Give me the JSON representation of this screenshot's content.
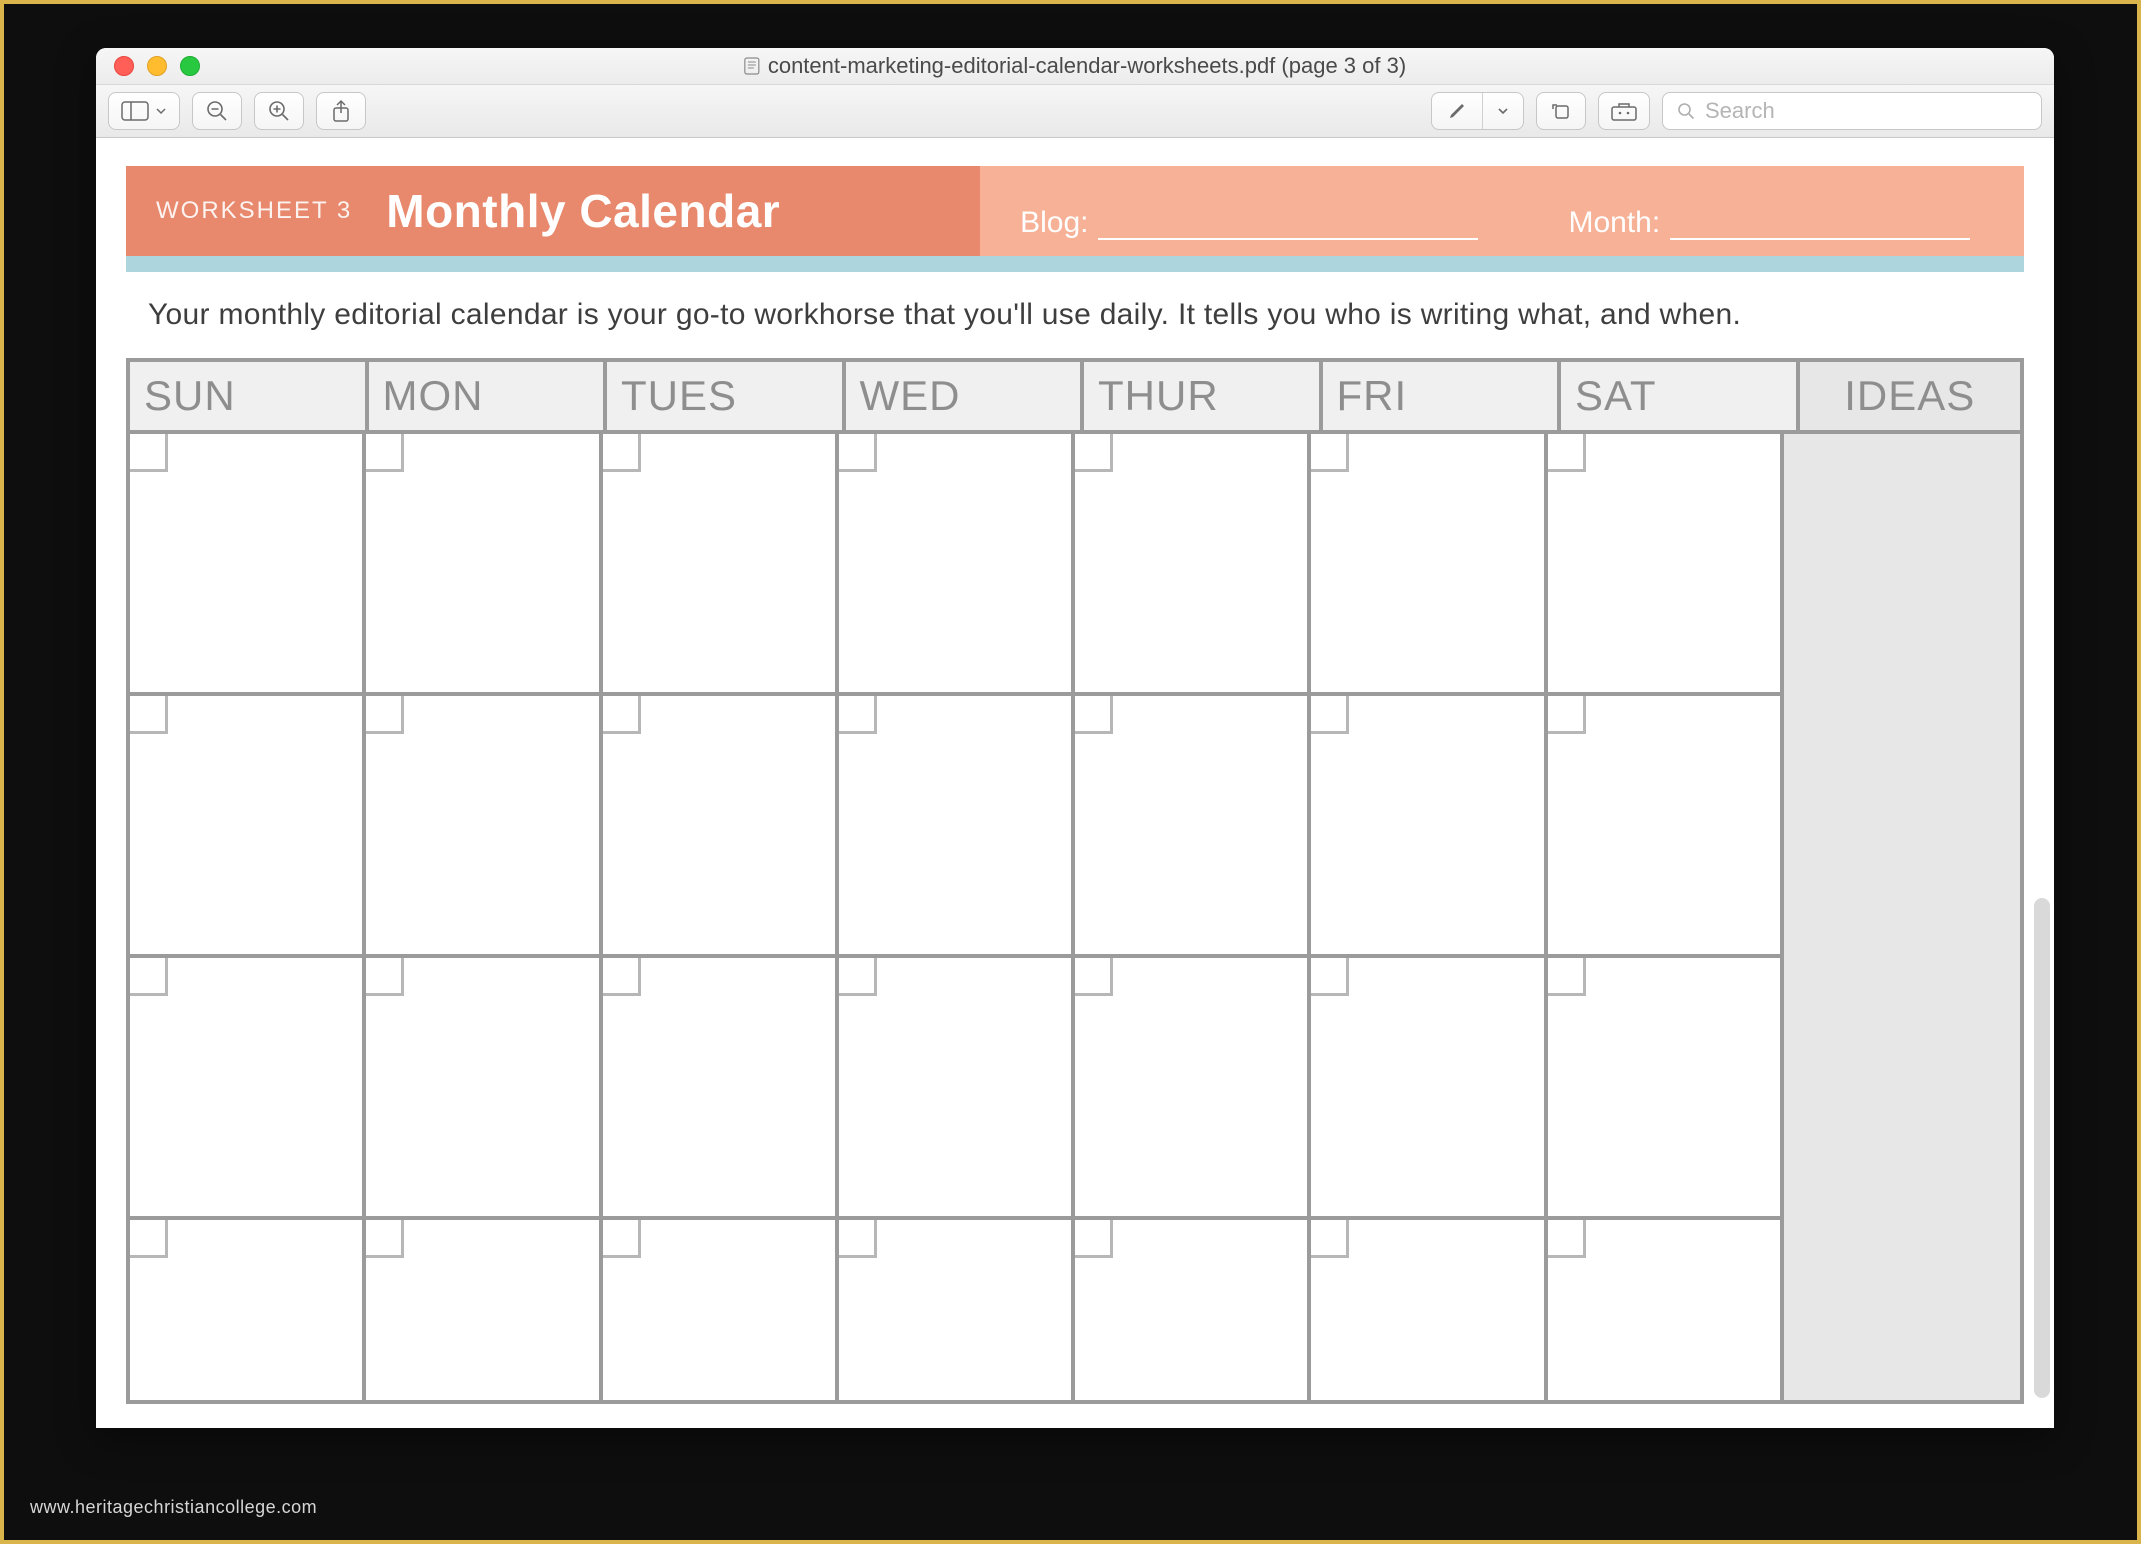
{
  "window": {
    "title": "content-marketing-editorial-calendar-worksheets.pdf (page 3 of 3)"
  },
  "toolbar": {
    "search_placeholder": "Search"
  },
  "worksheet": {
    "label": "WORKSHEET 3",
    "title": "Monthly Calendar",
    "blog_label": "Blog:",
    "month_label": "Month:",
    "intro": "Your monthly editorial calendar is your go-to workhorse that you'll use daily. It tells you who is writing what, and when.",
    "columns": [
      "SUN",
      "MON",
      "TUES",
      "WED",
      "THUR",
      "FRI",
      "SAT",
      "IDEAS"
    ]
  },
  "watermark": "www.heritagechristiancollege.com"
}
